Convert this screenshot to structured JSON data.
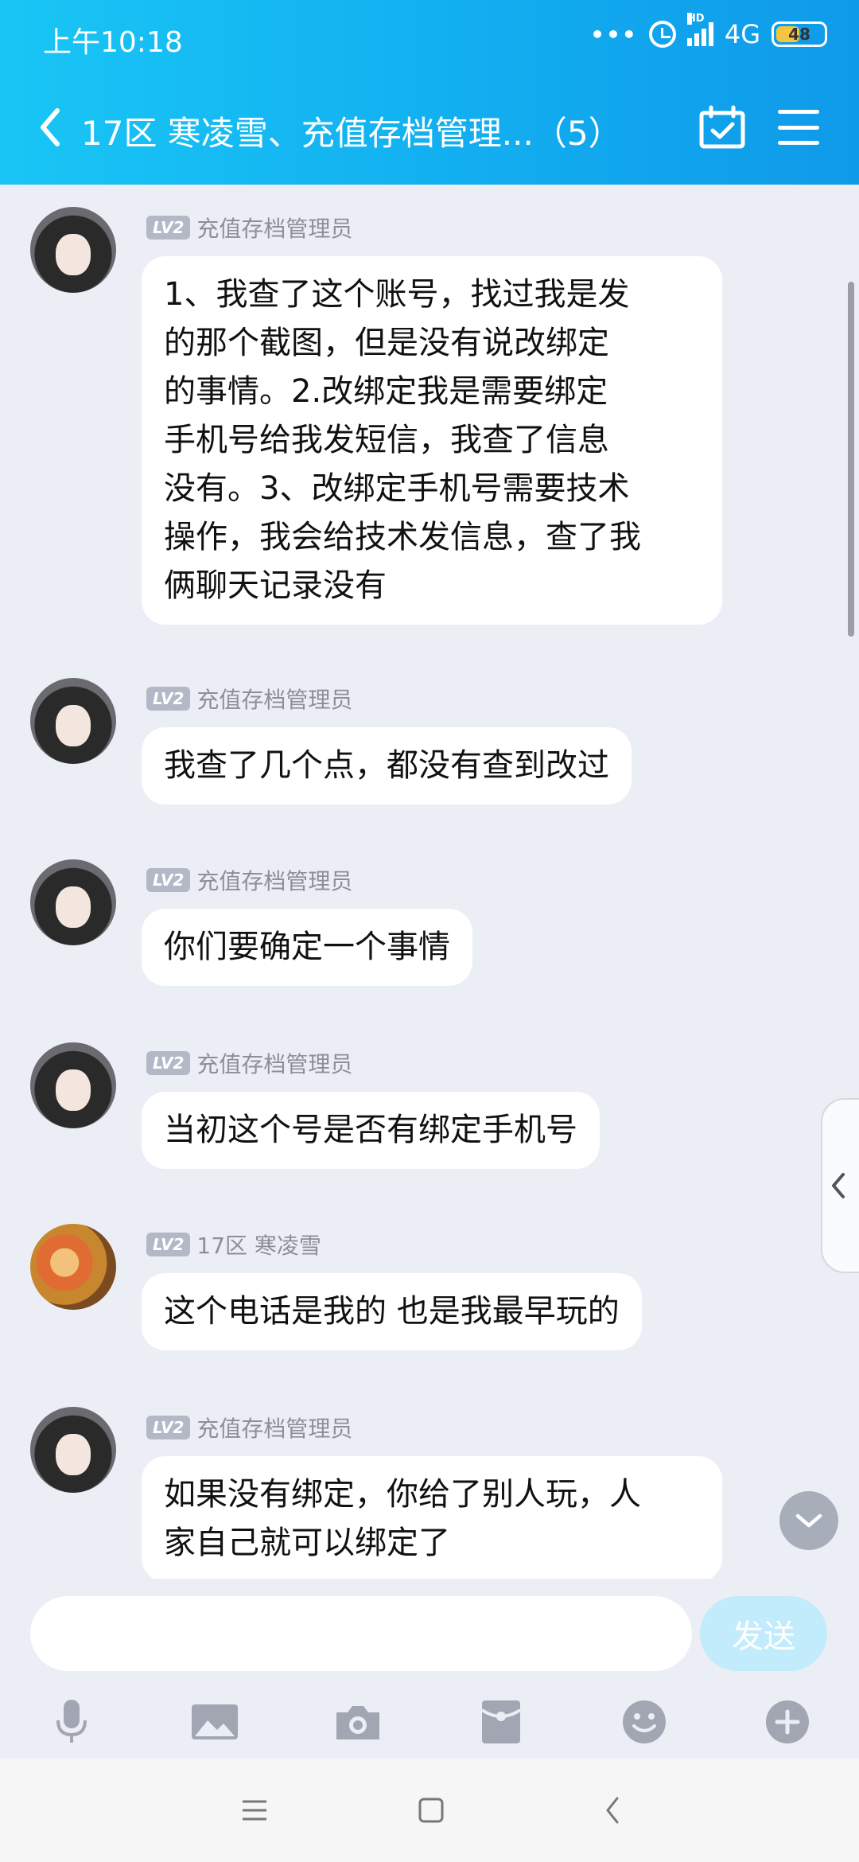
{
  "status_bar": {
    "time": "上午10:18",
    "network": "4G",
    "hd": "HD",
    "battery": "48"
  },
  "header": {
    "title": "17区 寒凌雪、充值存档管理...（5）"
  },
  "messages": [
    {
      "avatar": "admin-avatar",
      "level": "LV2",
      "sender": "充值存档管理员",
      "lines": [
        "1、我查了这个账号，找过我是发",
        "的那个截图，但是没有说改绑定",
        "的事情。2.改绑定我是需要绑定",
        "手机号给我发短信，我查了信息",
        "没有。3、改绑定手机号需要技术",
        "操作，我会给技术发信息，查了我",
        "俩聊天记录没有"
      ]
    },
    {
      "avatar": "admin-avatar",
      "level": "LV2",
      "sender": "充值存档管理员",
      "lines": [
        "我查了几个点，都没有查到改过"
      ]
    },
    {
      "avatar": "admin-avatar",
      "level": "LV2",
      "sender": "充值存档管理员",
      "lines": [
        "你们要确定一个事情"
      ]
    },
    {
      "avatar": "admin-avatar",
      "level": "LV2",
      "sender": "充值存档管理员",
      "lines": [
        "当初这个号是否有绑定手机号"
      ]
    },
    {
      "avatar": "user-avatar",
      "level": "LV2",
      "sender": "17区 寒凌雪",
      "lines": [
        "这个电话是我的 也是我最早玩的"
      ]
    },
    {
      "avatar": "admin-avatar",
      "level": "LV2",
      "sender": "充值存档管理员",
      "lines": [
        "如果没有绑定，你给了别人玩，人",
        "家自己就可以绑定了"
      ]
    }
  ],
  "input": {
    "value": "",
    "placeholder": "",
    "send_label": "发送"
  },
  "toolbar": [
    "microphone-icon",
    "image-icon",
    "camera-icon",
    "red-packet-icon",
    "emoji-icon",
    "plus-icon"
  ],
  "colors": {
    "header_start": "#19c6f5",
    "header_end": "#0f9ae9",
    "background": "#eceef5",
    "send_button": "#c2ecfb",
    "level_badge": "#b3b8c7"
  }
}
